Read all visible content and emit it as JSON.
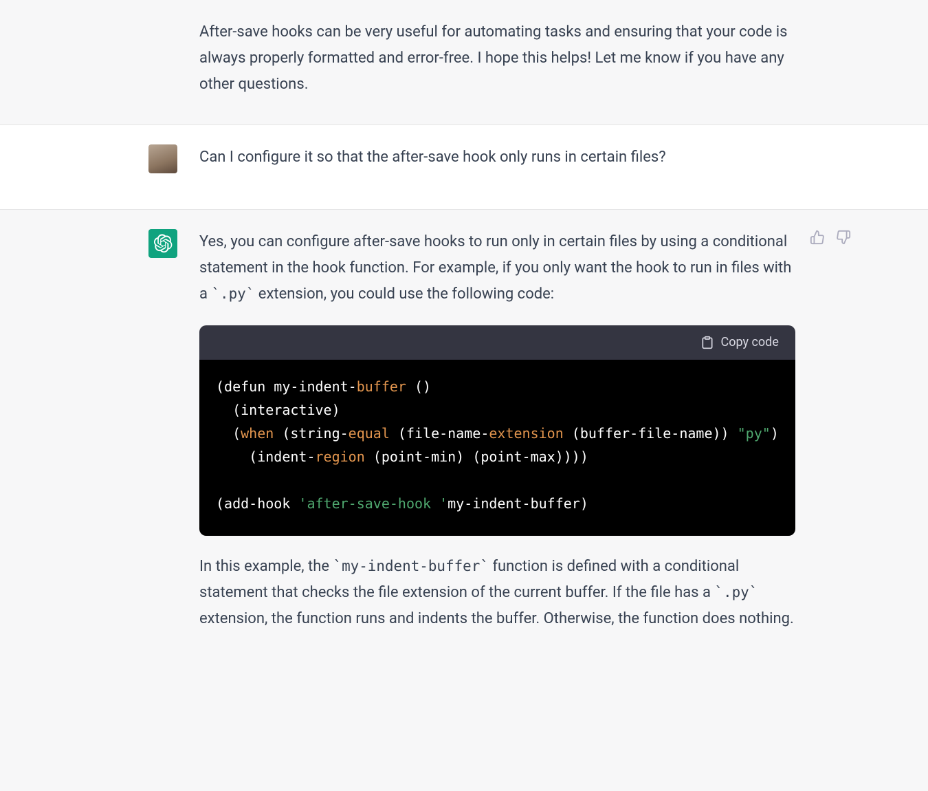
{
  "messages": {
    "intro_paragraph": "After-save hooks can be very useful for automating tasks and ensuring that your code is always properly formatted and error-free. I hope this helps! Let me know if you have any other questions.",
    "user_question": "Can I configure it so that the after-save hook only runs in certain files?",
    "assistant": {
      "p1_a": "Yes, you can configure after-save hooks to run only in certain files by using a conditional statement in the hook function. For example, if you only want the hook to run in files with a ",
      "p1_code": "`.py`",
      "p1_b": " extension, you could use the following code:",
      "p2_a": "In this example, the ",
      "p2_code1": "`my-indent-buffer`",
      "p2_b": " function is defined with a conditional statement that checks the file extension of the current buffer. If the file has a ",
      "p2_code2": "`.py`",
      "p2_c": " extension, the function runs and indents the buffer. Otherwise, the function does nothing."
    }
  },
  "code": {
    "copy_label": "Copy code",
    "raw": "(defun my-indent-buffer ()\n  (interactive)\n  (when (string-equal (file-name-extension (buffer-file-name)) \"py\")\n    (indent-region (point-min) (point-max))))\n\n(add-hook 'after-save-hook 'my-indent-buffer)",
    "tokens": {
      "l1_a": "(defun my-indent-",
      "l1_b": "buffer",
      "l1_c": " ()",
      "l2": "  (interactive)",
      "l3_a": "  (",
      "l3_b": "when",
      "l3_c": " (string-",
      "l3_d": "equal",
      "l3_e": " (file-name-",
      "l3_f": "extension",
      "l3_g": " (buffer-file-name)) ",
      "l3_h": "\"py\"",
      "l3_i": ")",
      "l4_a": "    (indent-",
      "l4_b": "region",
      "l4_c": " (point-min) (point-max))))",
      "l6_a": "(add-hook ",
      "l6_b": "'after-save-hook '",
      "l6_c": "my-indent-buffer)"
    }
  },
  "icons": {
    "thumbs_up": "thumbs-up-icon",
    "thumbs_down": "thumbs-down-icon",
    "clipboard": "clipboard-icon",
    "bot": "openai-logo-icon",
    "user": "user-avatar"
  }
}
